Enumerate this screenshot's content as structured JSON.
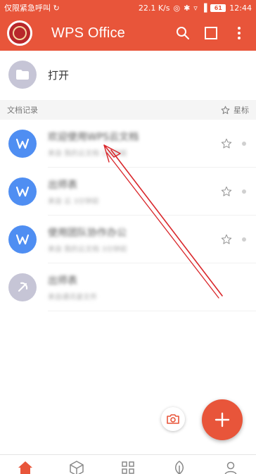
{
  "status_bar": {
    "left_text": "仅限紧急呼叫",
    "speed": "22.1 K/s",
    "battery": "61",
    "time": "12:44"
  },
  "app_bar": {
    "title": "WPS Office",
    "icons": [
      "search-icon",
      "multiwindow-icon",
      "more-icon"
    ]
  },
  "open_row": {
    "label": "打开",
    "icon": "folder-icon"
  },
  "section": {
    "title": "文档记录",
    "star_label": "星标"
  },
  "documents": [
    {
      "name": "欢迎使用WPS云文档",
      "meta": "来自 我的云文档   1分钟前",
      "icon": "wps-w-icon",
      "color": "#4f8ef2"
    },
    {
      "name": "出师表",
      "meta": "来自 云   3分钟前",
      "icon": "wps-w-icon",
      "color": "#4f8ef2"
    },
    {
      "name": "使用团队协作办公",
      "meta": "来自 我的云文档   3分钟前",
      "icon": "wps-w-icon",
      "color": "#4f8ef2"
    },
    {
      "name": "出师表",
      "meta": "来自通讯录文件",
      "icon": "unknown-file-icon",
      "color": "#c6c5d6"
    }
  ],
  "floating": {
    "camera_icon": "camera-icon",
    "fab_icon": "plus-icon"
  },
  "bottom_nav": [
    "home-icon",
    "cube-icon",
    "apps-grid-icon",
    "leaf-icon",
    "profile-icon"
  ],
  "colors": {
    "brand": "#e8553a",
    "doc_blue": "#4f8ef2",
    "muted": "#c6c5d6"
  }
}
